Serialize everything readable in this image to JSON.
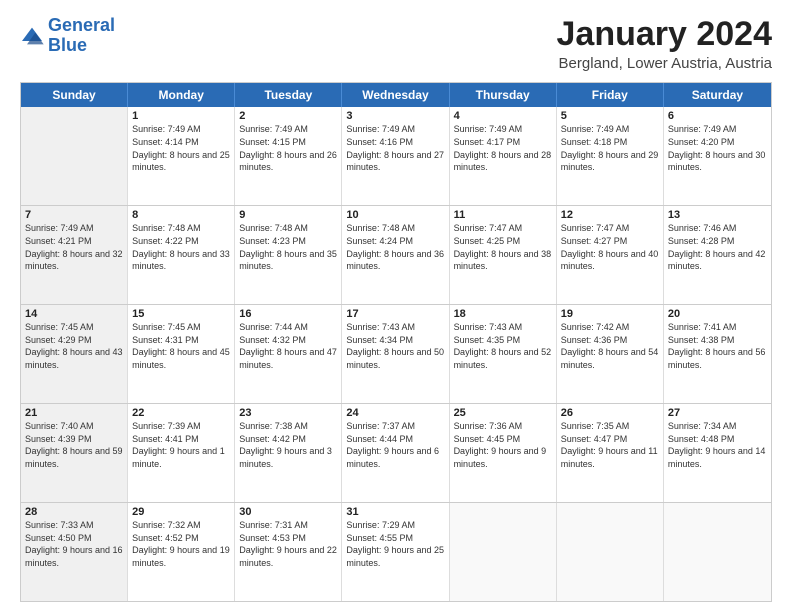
{
  "logo": {
    "line1": "General",
    "line2": "Blue"
  },
  "header": {
    "title": "January 2024",
    "subtitle": "Bergland, Lower Austria, Austria"
  },
  "days": [
    "Sunday",
    "Monday",
    "Tuesday",
    "Wednesday",
    "Thursday",
    "Friday",
    "Saturday"
  ],
  "rows": [
    [
      {
        "day": "",
        "sunrise": "",
        "sunset": "",
        "daylight": "",
        "shaded": true
      },
      {
        "day": "1",
        "sunrise": "Sunrise: 7:49 AM",
        "sunset": "Sunset: 4:14 PM",
        "daylight": "Daylight: 8 hours and 25 minutes."
      },
      {
        "day": "2",
        "sunrise": "Sunrise: 7:49 AM",
        "sunset": "Sunset: 4:15 PM",
        "daylight": "Daylight: 8 hours and 26 minutes."
      },
      {
        "day": "3",
        "sunrise": "Sunrise: 7:49 AM",
        "sunset": "Sunset: 4:16 PM",
        "daylight": "Daylight: 8 hours and 27 minutes."
      },
      {
        "day": "4",
        "sunrise": "Sunrise: 7:49 AM",
        "sunset": "Sunset: 4:17 PM",
        "daylight": "Daylight: 8 hours and 28 minutes."
      },
      {
        "day": "5",
        "sunrise": "Sunrise: 7:49 AM",
        "sunset": "Sunset: 4:18 PM",
        "daylight": "Daylight: 8 hours and 29 minutes."
      },
      {
        "day": "6",
        "sunrise": "Sunrise: 7:49 AM",
        "sunset": "Sunset: 4:20 PM",
        "daylight": "Daylight: 8 hours and 30 minutes."
      }
    ],
    [
      {
        "day": "7",
        "sunrise": "Sunrise: 7:49 AM",
        "sunset": "Sunset: 4:21 PM",
        "daylight": "Daylight: 8 hours and 32 minutes.",
        "shaded": true
      },
      {
        "day": "8",
        "sunrise": "Sunrise: 7:48 AM",
        "sunset": "Sunset: 4:22 PM",
        "daylight": "Daylight: 8 hours and 33 minutes."
      },
      {
        "day": "9",
        "sunrise": "Sunrise: 7:48 AM",
        "sunset": "Sunset: 4:23 PM",
        "daylight": "Daylight: 8 hours and 35 minutes."
      },
      {
        "day": "10",
        "sunrise": "Sunrise: 7:48 AM",
        "sunset": "Sunset: 4:24 PM",
        "daylight": "Daylight: 8 hours and 36 minutes."
      },
      {
        "day": "11",
        "sunrise": "Sunrise: 7:47 AM",
        "sunset": "Sunset: 4:25 PM",
        "daylight": "Daylight: 8 hours and 38 minutes."
      },
      {
        "day": "12",
        "sunrise": "Sunrise: 7:47 AM",
        "sunset": "Sunset: 4:27 PM",
        "daylight": "Daylight: 8 hours and 40 minutes."
      },
      {
        "day": "13",
        "sunrise": "Sunrise: 7:46 AM",
        "sunset": "Sunset: 4:28 PM",
        "daylight": "Daylight: 8 hours and 42 minutes."
      }
    ],
    [
      {
        "day": "14",
        "sunrise": "Sunrise: 7:45 AM",
        "sunset": "Sunset: 4:29 PM",
        "daylight": "Daylight: 8 hours and 43 minutes.",
        "shaded": true
      },
      {
        "day": "15",
        "sunrise": "Sunrise: 7:45 AM",
        "sunset": "Sunset: 4:31 PM",
        "daylight": "Daylight: 8 hours and 45 minutes."
      },
      {
        "day": "16",
        "sunrise": "Sunrise: 7:44 AM",
        "sunset": "Sunset: 4:32 PM",
        "daylight": "Daylight: 8 hours and 47 minutes."
      },
      {
        "day": "17",
        "sunrise": "Sunrise: 7:43 AM",
        "sunset": "Sunset: 4:34 PM",
        "daylight": "Daylight: 8 hours and 50 minutes."
      },
      {
        "day": "18",
        "sunrise": "Sunrise: 7:43 AM",
        "sunset": "Sunset: 4:35 PM",
        "daylight": "Daylight: 8 hours and 52 minutes."
      },
      {
        "day": "19",
        "sunrise": "Sunrise: 7:42 AM",
        "sunset": "Sunset: 4:36 PM",
        "daylight": "Daylight: 8 hours and 54 minutes."
      },
      {
        "day": "20",
        "sunrise": "Sunrise: 7:41 AM",
        "sunset": "Sunset: 4:38 PM",
        "daylight": "Daylight: 8 hours and 56 minutes."
      }
    ],
    [
      {
        "day": "21",
        "sunrise": "Sunrise: 7:40 AM",
        "sunset": "Sunset: 4:39 PM",
        "daylight": "Daylight: 8 hours and 59 minutes.",
        "shaded": true
      },
      {
        "day": "22",
        "sunrise": "Sunrise: 7:39 AM",
        "sunset": "Sunset: 4:41 PM",
        "daylight": "Daylight: 9 hours and 1 minute."
      },
      {
        "day": "23",
        "sunrise": "Sunrise: 7:38 AM",
        "sunset": "Sunset: 4:42 PM",
        "daylight": "Daylight: 9 hours and 3 minutes."
      },
      {
        "day": "24",
        "sunrise": "Sunrise: 7:37 AM",
        "sunset": "Sunset: 4:44 PM",
        "daylight": "Daylight: 9 hours and 6 minutes."
      },
      {
        "day": "25",
        "sunrise": "Sunrise: 7:36 AM",
        "sunset": "Sunset: 4:45 PM",
        "daylight": "Daylight: 9 hours and 9 minutes."
      },
      {
        "day": "26",
        "sunrise": "Sunrise: 7:35 AM",
        "sunset": "Sunset: 4:47 PM",
        "daylight": "Daylight: 9 hours and 11 minutes."
      },
      {
        "day": "27",
        "sunrise": "Sunrise: 7:34 AM",
        "sunset": "Sunset: 4:48 PM",
        "daylight": "Daylight: 9 hours and 14 minutes."
      }
    ],
    [
      {
        "day": "28",
        "sunrise": "Sunrise: 7:33 AM",
        "sunset": "Sunset: 4:50 PM",
        "daylight": "Daylight: 9 hours and 16 minutes.",
        "shaded": true
      },
      {
        "day": "29",
        "sunrise": "Sunrise: 7:32 AM",
        "sunset": "Sunset: 4:52 PM",
        "daylight": "Daylight: 9 hours and 19 minutes."
      },
      {
        "day": "30",
        "sunrise": "Sunrise: 7:31 AM",
        "sunset": "Sunset: 4:53 PM",
        "daylight": "Daylight: 9 hours and 22 minutes."
      },
      {
        "day": "31",
        "sunrise": "Sunrise: 7:29 AM",
        "sunset": "Sunset: 4:55 PM",
        "daylight": "Daylight: 9 hours and 25 minutes."
      },
      {
        "day": "",
        "sunrise": "",
        "sunset": "",
        "daylight": "",
        "empty": true
      },
      {
        "day": "",
        "sunrise": "",
        "sunset": "",
        "daylight": "",
        "empty": true
      },
      {
        "day": "",
        "sunrise": "",
        "sunset": "",
        "daylight": "",
        "empty": true
      }
    ]
  ]
}
